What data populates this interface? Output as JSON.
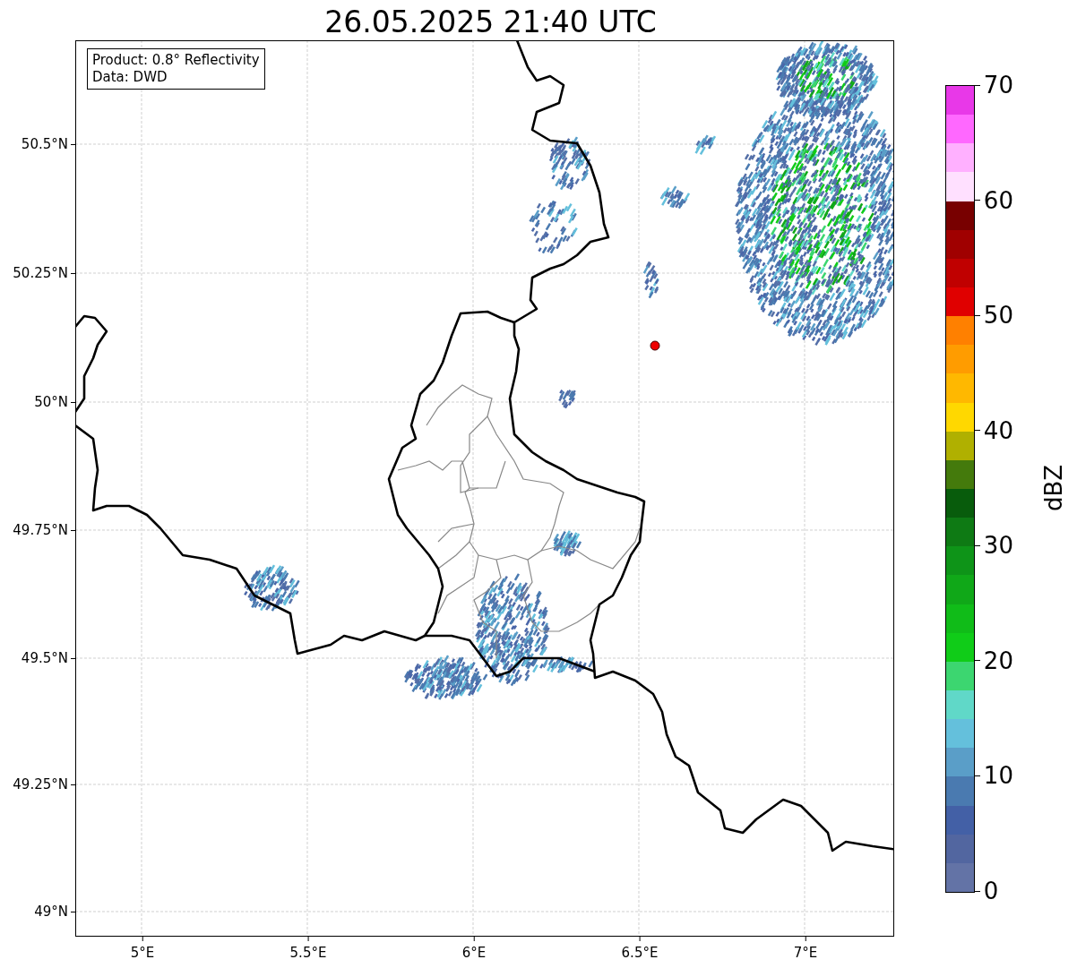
{
  "title": "26.05.2025 21:40 UTC",
  "info_box": [
    "Product: 0.8° Reflectivity",
    "Data: DWD"
  ],
  "y_axis": {
    "ticks": [
      "50.5°N",
      "50.25°N",
      "50°N",
      "49.75°N",
      "49.5°N",
      "49.25°N",
      "49°N"
    ]
  },
  "x_axis": {
    "ticks": [
      "5°E",
      "5.5°E",
      "6°E",
      "6.5°E",
      "7°E"
    ]
  },
  "colorbar": {
    "label": "dBZ",
    "ticks": [
      "70",
      "60",
      "50",
      "40",
      "30",
      "20",
      "10",
      "0"
    ],
    "bands": [
      {
        "color": "#e838e8"
      },
      {
        "color": "#ff68ff"
      },
      {
        "color": "#ffb0ff"
      },
      {
        "color": "#ffe0ff"
      },
      {
        "color": "#780000"
      },
      {
        "color": "#a00000"
      },
      {
        "color": "#c00000"
      },
      {
        "color": "#e00000"
      },
      {
        "color": "#ff8000"
      },
      {
        "color": "#ff9c00"
      },
      {
        "color": "#ffb800"
      },
      {
        "color": "#ffd800"
      },
      {
        "color": "#b0b000"
      },
      {
        "color": "#447a0c"
      },
      {
        "color": "#085c0c"
      },
      {
        "color": "#0e7a14"
      },
      {
        "color": "#0e9418"
      },
      {
        "color": "#10a818"
      },
      {
        "color": "#10bc18"
      },
      {
        "color": "#10cc18"
      },
      {
        "color": "#3cd670"
      },
      {
        "color": "#60d8c8"
      },
      {
        "color": "#64c0dc"
      },
      {
        "color": "#5a9ec8"
      },
      {
        "color": "#4a7ab0"
      },
      {
        "color": "#4360a6"
      },
      {
        "color": "#5266a0"
      },
      {
        "color": "#6373a6"
      }
    ]
  }
}
